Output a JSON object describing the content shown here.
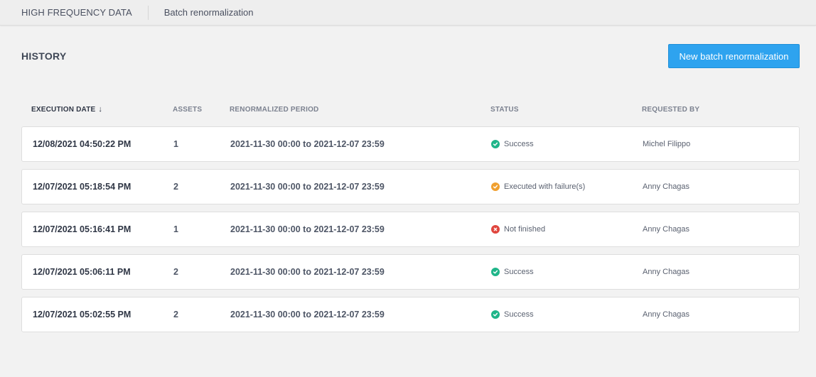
{
  "breadcrumb": {
    "root": "HIGH FREQUENCY DATA",
    "page": "Batch renormalization"
  },
  "header": {
    "title": "HISTORY",
    "new_button_label": "New batch renormalization"
  },
  "colors": {
    "primary": "#2ea3ef",
    "success": "#1fb589",
    "warning": "#f0a030",
    "error": "#e0453d"
  },
  "table": {
    "columns": {
      "execution_date": "EXECUTION DATE",
      "assets": "ASSETS",
      "renormalized_period": "RENORMALIZED PERIOD",
      "status": "STATUS",
      "requested_by": "REQUESTED BY"
    },
    "sort_icon": "arrow-down-icon",
    "rows": [
      {
        "date": "12/08/2021 04:50:22 PM",
        "assets": "1",
        "period": "2021-11-30 00:00 to 2021-12-07 23:59",
        "status": "Success",
        "status_type": "success",
        "requested_by": "Michel Filippo"
      },
      {
        "date": "12/07/2021 05:18:54 PM",
        "assets": "2",
        "period": "2021-11-30 00:00 to 2021-12-07 23:59",
        "status": "Executed with failure(s)",
        "status_type": "warning",
        "requested_by": "Anny Chagas"
      },
      {
        "date": "12/07/2021 05:16:41 PM",
        "assets": "1",
        "period": "2021-11-30 00:00 to 2021-12-07 23:59",
        "status": "Not finished",
        "status_type": "error",
        "requested_by": "Anny Chagas"
      },
      {
        "date": "12/07/2021 05:06:11 PM",
        "assets": "2",
        "period": "2021-11-30 00:00 to 2021-12-07 23:59",
        "status": "Success",
        "status_type": "success",
        "requested_by": "Anny Chagas"
      },
      {
        "date": "12/07/2021 05:02:55 PM",
        "assets": "2",
        "period": "2021-11-30 00:00 to 2021-12-07 23:59",
        "status": "Success",
        "status_type": "success",
        "requested_by": "Anny Chagas"
      }
    ]
  }
}
